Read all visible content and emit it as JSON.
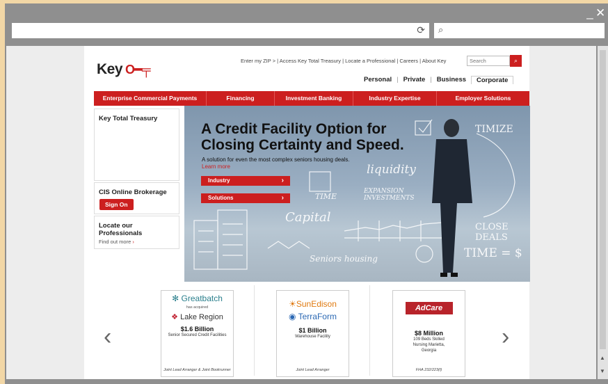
{
  "window": {
    "minimize": "_",
    "close": "✕"
  },
  "browser": {
    "url": "",
    "search": ""
  },
  "header": {
    "logo": "Key",
    "toplinks": "Enter my ZIP > | Access Key Total Treasury | Locate a Professional | Careers | About Key",
    "search_placeholder": "Search",
    "segments": [
      "Personal",
      "Private",
      "Business",
      "Corporate"
    ]
  },
  "nav": [
    "Enterprise Commercial Payments",
    "Financing",
    "Investment Banking",
    "Industry Expertise",
    "Employer Solutions"
  ],
  "sidebar": {
    "ktt_title": "Key Total Treasury",
    "cis_title": "CIS Online Brokerage",
    "signon": "Sign On",
    "locate_title": "Locate our Professionals",
    "find_out": "Find out more"
  },
  "hero": {
    "title": "A Credit Facility Option for Closing Certainty and Speed.",
    "subtitle": "A solution for even the most complex seniors housing deals.",
    "learn_more": "Learn more",
    "btn_industry": "Industry",
    "btn_solutions": "Solutions",
    "sketch": [
      "TIME",
      "liquidity",
      "EXPANSION INVESTMENTS",
      "Capital",
      "Seniors housing",
      "TIME = $",
      "CLOSE DEALS",
      "TIMIZE"
    ]
  },
  "deals": [
    {
      "logo1": "Greatbatch",
      "small": "has acquired",
      "logo2": "Lake Region",
      "amount": "$1.6 Billion",
      "desc": "Senior Secured Credit Facilities",
      "foot": "Joint Lead Arranger & Joint Bookrunner"
    },
    {
      "logo1": "SunEdison",
      "small": "",
      "logo2": "TerraForm",
      "amount": "$1 Billion",
      "desc": "Warehouse Facility",
      "foot": "Joint Lead Arranger"
    },
    {
      "logo1": "AdCare",
      "small": "",
      "logo2": "",
      "amount": "$8 Million",
      "desc": "109 Beds Skilled Nursing Marietta, Georgia",
      "foot": "FHA 232/223(f)"
    }
  ],
  "colors": {
    "brand_red": "#cc1f1f"
  }
}
